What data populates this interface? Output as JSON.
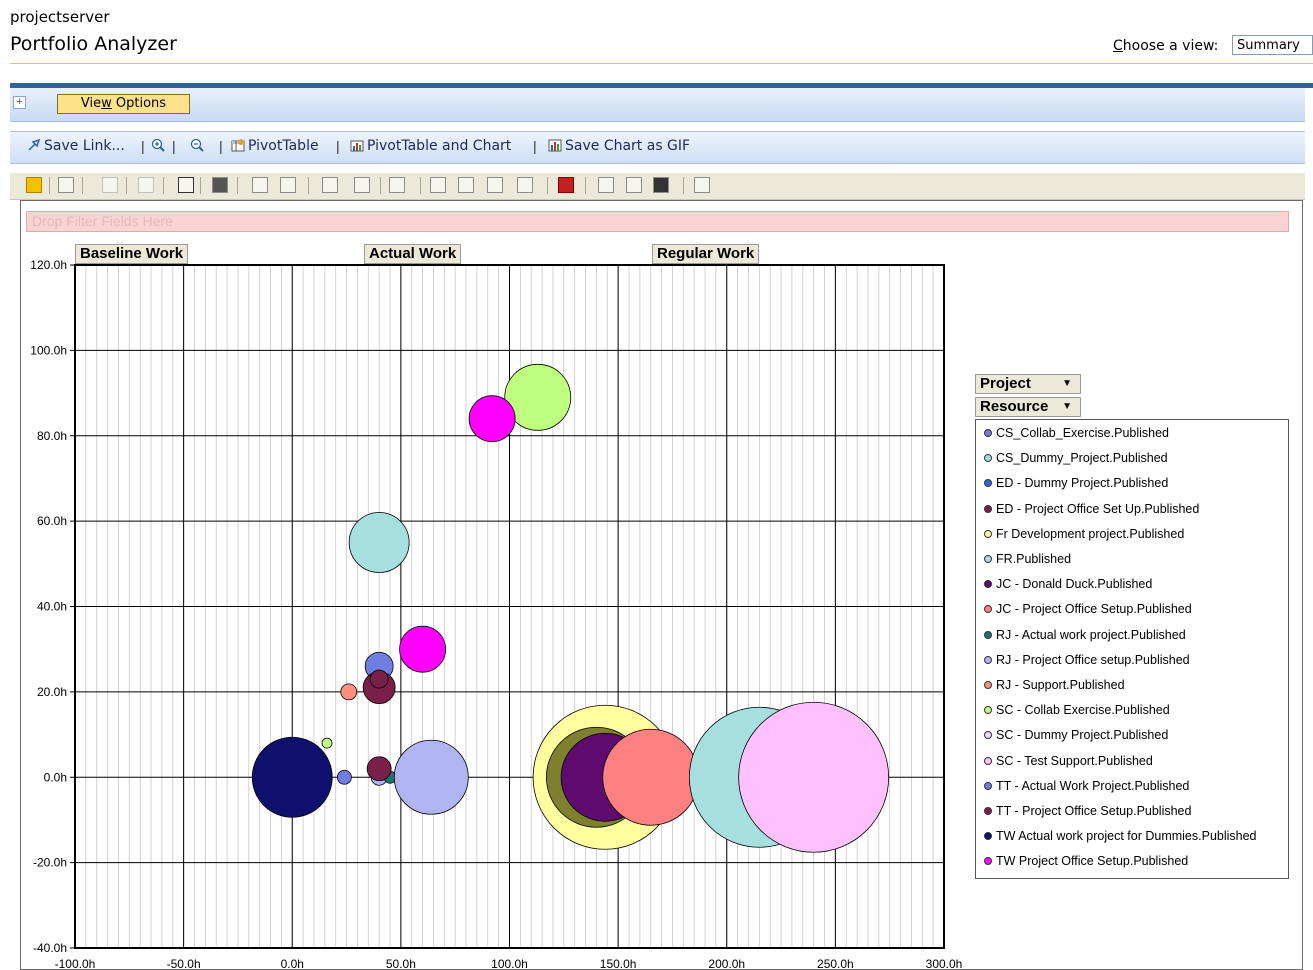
{
  "header": {
    "site": "projectserver",
    "title": "Portfolio Analyzer",
    "view_label": "Choose a view:",
    "view_value": "Summary"
  },
  "options_bar": {
    "view_options": "View Options"
  },
  "toolbar": {
    "save_link": "Save Link...",
    "pivot_table": "PivotTable",
    "pivot_table_chart": "PivotTable and Chart",
    "save_chart_gif": "Save Chart as GIF"
  },
  "pivot": {
    "filter_placeholder": "Drop Filter Fields Here",
    "fields": {
      "baseline": "Baseline Work",
      "actual": "Actual Work",
      "regular": "Regular Work",
      "project": "Project",
      "resource": "Resource"
    }
  },
  "chart_data": {
    "type": "scatter",
    "x_ticks": [
      "-100.0h",
      "-50.0h",
      "0.0h",
      "50.0h",
      "100.0h",
      "150.0h",
      "200.0h",
      "250.0h",
      "300.0h"
    ],
    "y_ticks": [
      "120.0h",
      "100.0h",
      "80.0h",
      "60.0h",
      "40.0h",
      "20.0h",
      "0.0h",
      "-20.0h",
      "-40.0h"
    ],
    "xlim": [
      -100,
      300
    ],
    "ylim": [
      -40,
      120
    ],
    "grid": true,
    "legend_position": "right",
    "series": [
      {
        "name": "CS_Collab_Exercise.Published",
        "color": "#7b7bd6"
      },
      {
        "name": "CS_Dummy_Project.Published",
        "color": "#9fe0e0"
      },
      {
        "name": "ED - Dummy Project.Published",
        "color": "#2f6ad2"
      },
      {
        "name": "ED - Project Office Set Up.Published",
        "color": "#7a1f4a"
      },
      {
        "name": "Fr Development project.Published",
        "color": "#ffff9f"
      },
      {
        "name": "FR.Published",
        "color": "#a7dfe0"
      },
      {
        "name": "JC - Donald Duck.Published",
        "color": "#5f0a6e"
      },
      {
        "name": "JC - Project Office Setup.Published",
        "color": "#ff8080"
      },
      {
        "name": "RJ - Actual work project.Published",
        "color": "#1f7070"
      },
      {
        "name": "RJ - Project Office setup.Published",
        "color": "#b0b4f0"
      },
      {
        "name": "RJ - Support.Published",
        "color": "#ff8f7f"
      },
      {
        "name": "SC - Collab Exercise.Published",
        "color": "#bfff7f"
      },
      {
        "name": "SC - Dummy Project.Published",
        "color": "#efd7ff"
      },
      {
        "name": "SC - Test Support.Published",
        "color": "#ffc0ff"
      },
      {
        "name": "TT - Actual Work Project.Published",
        "color": "#6f7fdf"
      },
      {
        "name": "TT - Project Office Setup.Published",
        "color": "#7a1f4a"
      },
      {
        "name": "TW Actual work project for Dummies.Published",
        "color": "#0f0f6e"
      },
      {
        "name": "TW Project Office Setup.Published",
        "color": "#ff00ff"
      }
    ],
    "points": [
      {
        "x": 113,
        "y": 89,
        "size": 33,
        "color": "#bfff7f"
      },
      {
        "x": 92,
        "y": 84,
        "size": 23,
        "color": "#ff00ff"
      },
      {
        "x": 40,
        "y": 55,
        "size": 30,
        "color": "#a7dfe0"
      },
      {
        "x": 60,
        "y": 30,
        "size": 23,
        "color": "#ff00ff"
      },
      {
        "x": 40,
        "y": 26,
        "size": 14,
        "color": "#6f7fdf"
      },
      {
        "x": 40,
        "y": 21,
        "size": 16,
        "color": "#7a1f4a"
      },
      {
        "x": 40,
        "y": 23,
        "size": 9,
        "color": "#7a1f4a"
      },
      {
        "x": 26,
        "y": 20,
        "size": 8,
        "color": "#ff8f7f"
      },
      {
        "x": 16,
        "y": 8,
        "size": 5,
        "color": "#bfff7f"
      },
      {
        "x": 0,
        "y": 0,
        "size": 40,
        "color": "#0f0f6e"
      },
      {
        "x": 24,
        "y": 0,
        "size": 7,
        "color": "#6f7fdf"
      },
      {
        "x": 40,
        "y": 0,
        "size": 8,
        "color": "#b0b4f0"
      },
      {
        "x": 45,
        "y": 0,
        "size": 6,
        "color": "#1f7070"
      },
      {
        "x": 40,
        "y": 2,
        "size": 12,
        "color": "#7a1f4a"
      },
      {
        "x": 64,
        "y": 0,
        "size": 37,
        "color": "#b0b4f0"
      },
      {
        "x": 144,
        "y": 0,
        "size": 72,
        "color": "#ffff9f"
      },
      {
        "x": 140,
        "y": 0,
        "size": 50,
        "color": "#7f7f30"
      },
      {
        "x": 144,
        "y": 0,
        "size": 44,
        "color": "#5f0a6e"
      },
      {
        "x": 165,
        "y": 0,
        "size": 48,
        "color": "#ff8080"
      },
      {
        "x": 215,
        "y": 0,
        "size": 70,
        "color": "#a7dfe0"
      },
      {
        "x": 240,
        "y": 0,
        "size": 75,
        "color": "#ffc0ff"
      }
    ]
  }
}
